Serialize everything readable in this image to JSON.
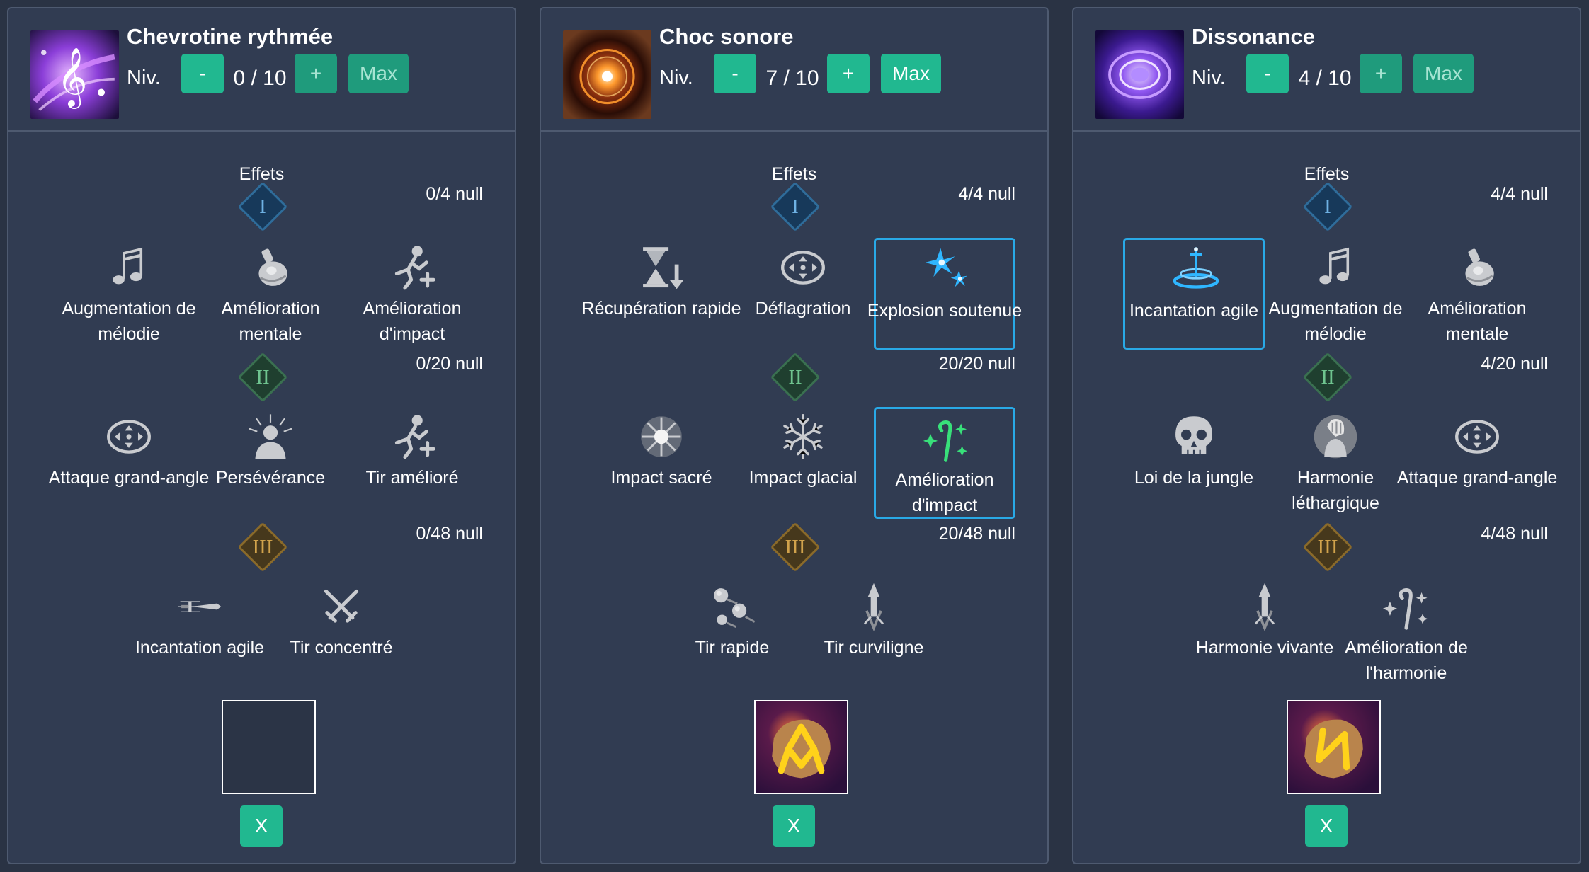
{
  "colors": {
    "accent": "#21b890",
    "background": "#2a3344",
    "panel": "#313c52",
    "selected_border": "#29a9e6"
  },
  "panels": [
    {
      "skill_name": "Chevrotine rythmée",
      "skill_icon": "music-note-wave-icon",
      "level_label": "Niv.",
      "minus_label": "-",
      "level_value": "0 / 10",
      "plus_label": "+",
      "max_label": "Max",
      "effects_title": "Effets",
      "tiers": [
        {
          "roman": "I",
          "count": "0/4 null",
          "effects": [
            {
              "label": "Augmentation de mélodie",
              "icon": "music-notes-icon",
              "selected": false
            },
            {
              "label": "Amélioration mentale",
              "icon": "potion-flask-icon",
              "selected": false
            },
            {
              "label": "Amélioration d'impact",
              "icon": "sprint-plus-icon",
              "selected": false
            }
          ]
        },
        {
          "roman": "II",
          "count": "0/20 null",
          "effects": [
            {
              "label": "Attaque grand-angle",
              "icon": "wide-arrows-icon",
              "selected": false
            },
            {
              "label": "Persévérance",
              "icon": "figure-burst-icon",
              "selected": false
            },
            {
              "label": "Tir amélioré",
              "icon": "sprint-plus-icon",
              "selected": false
            }
          ]
        },
        {
          "roman": "III",
          "count": "0/48 null",
          "effects": [
            {
              "label": "Incantation agile",
              "icon": "swift-sword-icon",
              "selected": false
            },
            {
              "label": "Tir concentré",
              "icon": "crossed-swords-icon",
              "selected": false
            }
          ]
        }
      ],
      "rune": "empty-rune-slot",
      "remove_label": "X"
    },
    {
      "skill_name": "Choc sonore",
      "skill_icon": "fire-orb-icon",
      "level_label": "Niv.",
      "minus_label": "-",
      "level_value": "7 / 10",
      "plus_label": "+",
      "max_label": "Max",
      "effects_title": "Effets",
      "tiers": [
        {
          "roman": "I",
          "count": "4/4 null",
          "effects": [
            {
              "label": "Récupération rapide",
              "icon": "hourglass-arrow-icon",
              "selected": false
            },
            {
              "label": "Déflagration",
              "icon": "wide-arrows-icon",
              "selected": false
            },
            {
              "label": "Explosion soutenue",
              "icon": "blue-sparks-icon",
              "selected": true
            }
          ]
        },
        {
          "roman": "II",
          "count": "20/20 null",
          "effects": [
            {
              "label": "Impact sacré",
              "icon": "holy-sun-icon",
              "selected": false
            },
            {
              "label": "Impact glacial",
              "icon": "snowflake-icon",
              "selected": false
            },
            {
              "label": "Amélioration d'impact",
              "icon": "green-staff-sparkle-icon",
              "selected": true
            }
          ]
        },
        {
          "roman": "III",
          "count": "20/48 null",
          "effects": [
            {
              "label": "Tir rapide",
              "icon": "comets-icon",
              "selected": false
            },
            {
              "label": "Tir curviligne",
              "icon": "arrow-up-icon",
              "selected": false
            }
          ]
        }
      ],
      "rune": "gold-rune-wunjo",
      "remove_label": "X"
    },
    {
      "skill_name": "Dissonance",
      "skill_icon": "purple-vortex-icon",
      "level_label": "Niv.",
      "minus_label": "-",
      "level_value": "4 / 10",
      "plus_label": "+",
      "max_label": "Max",
      "effects_title": "Effets",
      "tiers": [
        {
          "roman": "I",
          "count": "4/4 null",
          "effects": [
            {
              "label": "Incantation agile",
              "icon": "blue-sword-pedestal-icon",
              "selected": true
            },
            {
              "label": "Augmentation de mélodie",
              "icon": "music-notes-icon",
              "selected": false
            },
            {
              "label": "Amélioration mentale",
              "icon": "potion-flask-icon",
              "selected": false
            }
          ]
        },
        {
          "roman": "II",
          "count": "4/20 null",
          "effects": [
            {
              "label": "Loi de la jungle",
              "icon": "skull-icon",
              "selected": false
            },
            {
              "label": "Harmonie léthargique",
              "icon": "face-palm-icon",
              "selected": false
            },
            {
              "label": "Attaque grand-angle",
              "icon": "wide-arrows-icon",
              "selected": false
            }
          ]
        },
        {
          "roman": "III",
          "count": "4/48 null",
          "effects": [
            {
              "label": "Harmonie vivante",
              "icon": "arrow-up-icon",
              "selected": false
            },
            {
              "label": "Amélioration de l'harmonie",
              "icon": "staff-sparkle-icon",
              "selected": false
            }
          ]
        }
      ],
      "rune": "gold-rune-sowilo",
      "remove_label": "X"
    }
  ]
}
